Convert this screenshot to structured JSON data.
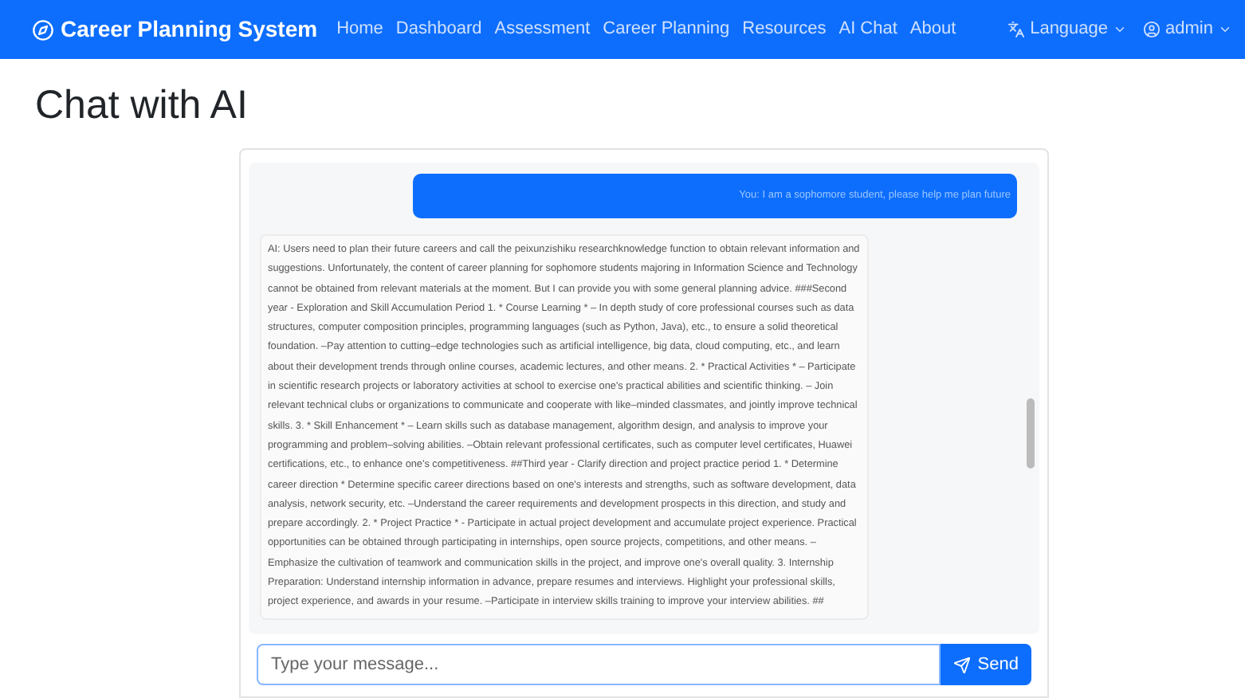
{
  "navbar": {
    "brand": "Career Planning System",
    "links": [
      {
        "label": "Home",
        "selected": false
      },
      {
        "label": "Dashboard",
        "selected": false
      },
      {
        "label": "Assessment",
        "selected": false
      },
      {
        "label": "Career Planning",
        "selected": false
      },
      {
        "label": "Resources",
        "selected": false
      },
      {
        "label": "AI Chat",
        "selected": false
      },
      {
        "label": "About",
        "selected": false
      }
    ],
    "language": "Language",
    "user": "admin"
  },
  "page_title": "Chat with AI",
  "messages": [
    {
      "kind": "user",
      "text": "You: I am a sophomore student, please help me plan future"
    },
    {
      "kind": "ai",
      "text": "AI: Users need to plan their future careers and call the peixunzishiku researchknowledge function to obtain relevant information and suggestions. Unfortunately, the content of career planning for sophomore students majoring in Information Science and Technology cannot be obtained from relevant materials at the moment. But I can provide you with some general planning advice. ###Second year - Exploration and Skill Accumulation Period 1. * Course Learning * – In depth study of core professional courses such as data structures, computer composition principles, programming languages (such as Python, Java), etc., to ensure a solid theoretical foundation. –Pay attention to cutting–edge technologies such as artificial intelligence, big data, cloud computing, etc., and learn about their development trends through online courses, academic lectures, and other means. 2. * Practical Activities * – Participate in scientific research projects or laboratory activities at school to exercise one's practical abilities and scientific thinking. – Join relevant technical clubs or organizations to communicate and cooperate with like–minded classmates, and jointly improve technical skills. 3. * Skill Enhancement * – Learn skills such as database management, algorithm design, and analysis to improve your programming and problem–solving abilities. –Obtain relevant professional certificates, such as computer level certificates, Huawei certifications, etc., to enhance one's competitiveness. ##Third year - Clarify direction and project practice period 1. * Determine career direction * Determine specific career directions based on one's interests and strengths, such as software development, data analysis, network security, etc. –Understand the career requirements and development prospects in this direction, and study and prepare accordingly. 2. * Project Practice * - Participate in actual project development and accumulate project experience. Practical opportunities can be obtained through participating in internships, open source projects, competitions, and other means. –Emphasize the cultivation of teamwork and communication skills in the project, and improve one's overall quality. 3. Internship Preparation: Understand internship information in advance, prepare resumes and interviews. Highlight your professional skills, project experience, and awards in your resume. –Participate in interview skills training to improve your interview abilities. ##"
    }
  ],
  "input": {
    "placeholder": "Type your message...",
    "button": "Send"
  }
}
